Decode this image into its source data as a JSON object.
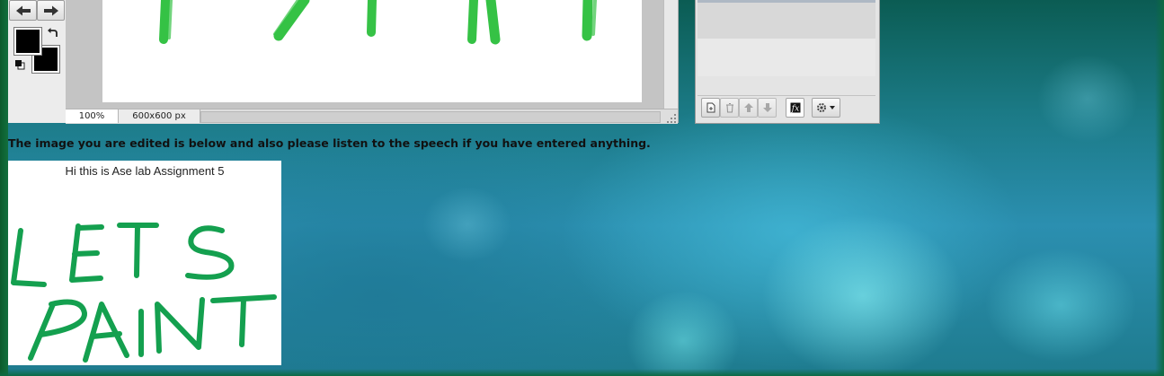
{
  "editor": {
    "zoom": "100%",
    "canvas_size": "600x600 px",
    "undo_icon": "arrow-left-icon",
    "redo_icon": "arrow-right-icon",
    "primary_color": "#000000",
    "secondary_color": "#000000",
    "brush_color": "#2bbf3c"
  },
  "layers_panel": {
    "buttons": [
      "new-layer-icon",
      "delete-layer-icon",
      "move-up-icon",
      "move-down-icon",
      "fx-icon",
      "settings-icon"
    ]
  },
  "page": {
    "notice": "The image you are edited is below and also please listen to the speech if you have entered anything.",
    "result_caption": "Hi this is Ase lab Assignment 5",
    "result_stroke_color": "#14a04f"
  }
}
